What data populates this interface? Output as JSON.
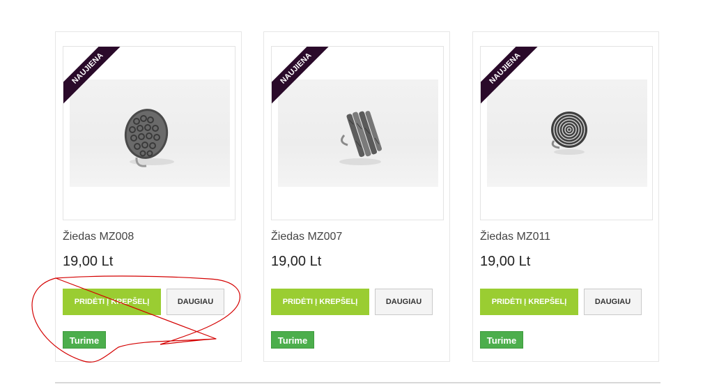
{
  "products": [
    {
      "badge": "NAUJIENA",
      "title": "Žiedas MZ008",
      "price": "19,00 Lt",
      "add_to_cart_label": "PRIDĖTI Į KREPŠELĮ",
      "more_label": "DAUGIAU",
      "stock_label": "Turime",
      "image_icon": "ring-textured-round-icon"
    },
    {
      "badge": "NAUJIENA",
      "title": "Žiedas MZ007",
      "price": "19,00 Lt",
      "add_to_cart_label": "PRIDĖTI Į KREPŠELĮ",
      "more_label": "DAUGIAU",
      "stock_label": "Turime",
      "image_icon": "ring-striped-icon"
    },
    {
      "badge": "NAUJIENA",
      "title": "Žiedas MZ011",
      "price": "19,00 Lt",
      "add_to_cart_label": "PRIDĖTI Į KREPŠELĮ",
      "more_label": "DAUGIAU",
      "stock_label": "Turime",
      "image_icon": "ring-spiral-icon"
    }
  ],
  "colors": {
    "add_button": "#9acd32",
    "stock_badge": "#4cae4c",
    "ribbon": "#2a0a2a",
    "annotation_stroke": "#d40000"
  }
}
